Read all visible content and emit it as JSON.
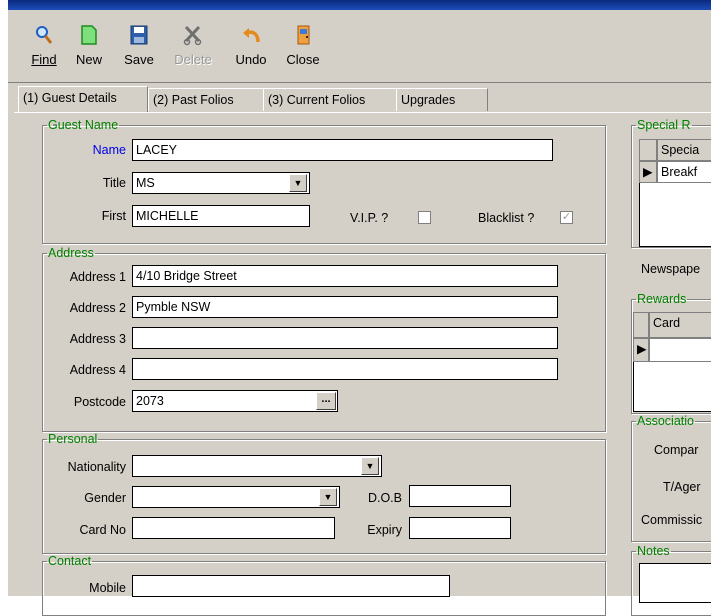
{
  "toolbar": {
    "find": "Find",
    "new": "New",
    "save": "Save",
    "delete": "Delete",
    "undo": "Undo",
    "close": "Close"
  },
  "tabs": [
    "(1) Guest Details",
    "(2) Past Folios",
    "(3) Current Folios",
    "Upgrades"
  ],
  "guest_name": {
    "legend": "Guest Name",
    "name_label": "Name",
    "name_value": "LACEY",
    "title_label": "Title",
    "title_value": "MS",
    "first_label": "First",
    "first_value": "MICHELLE",
    "vip_label": "V.I.P. ?",
    "blacklist_label": "Blacklist ?"
  },
  "address": {
    "legend": "Address",
    "address1_label": "Address 1",
    "address1_value": "4/10 Bridge Street",
    "address2_label": "Address 2",
    "address2_value": "Pymble NSW",
    "address3_label": "Address 3",
    "address3_value": "",
    "address4_label": "Address 4",
    "address4_value": "",
    "postcode_label": "Postcode",
    "postcode_value": "2073",
    "ellipsis": "..."
  },
  "personal": {
    "legend": "Personal",
    "nationality_label": "Nationality",
    "gender_label": "Gender",
    "dob_label": "D.O.B",
    "cardno_label": "Card No",
    "expiry_label": "Expiry"
  },
  "contact": {
    "legend": "Contact",
    "mobile_label": "Mobile"
  },
  "special": {
    "legend": "Special R",
    "col": "Specia",
    "row1": "Breakf"
  },
  "newspaper_label": "Newspape",
  "rewards": {
    "legend": "Rewards",
    "col": "Card"
  },
  "association": {
    "legend": "Associatio",
    "company_label": "Compar",
    "tagent_label": "T/Ager",
    "commission_label": "Commissic"
  },
  "notes": {
    "legend": "Notes"
  }
}
